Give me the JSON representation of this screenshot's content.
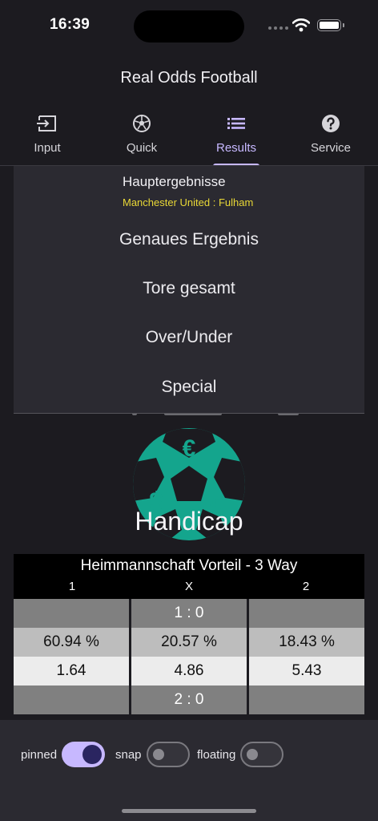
{
  "status": {
    "time": "16:39"
  },
  "app": {
    "title": "Real Odds Football"
  },
  "tabs": [
    {
      "label": "Input",
      "icon": "input-icon"
    },
    {
      "label": "Quick",
      "icon": "soccer-ball-icon"
    },
    {
      "label": "Results",
      "icon": "list-icon",
      "active": true
    },
    {
      "label": "Service",
      "icon": "help-icon"
    }
  ],
  "menu": {
    "title": "Hauptergebnisse",
    "subtitle": "Manchester United : Fulham",
    "options": [
      "Genaues Ergebnis",
      "Tore gesamt",
      "Over/Under",
      "Special"
    ]
  },
  "section": {
    "title": "Handicap",
    "logo_icon": "money-ball-icon"
  },
  "table": {
    "title": "Heimmannschaft Vorteil - 3 Way",
    "headers": [
      "1",
      "X",
      "2"
    ],
    "rows": [
      {
        "type": "score",
        "cells": [
          "",
          "1 : 0",
          ""
        ]
      },
      {
        "type": "pct",
        "cells": [
          "60.94 %",
          "20.57 %",
          "18.43 %"
        ]
      },
      {
        "type": "odd",
        "cells": [
          "1.64",
          "4.86",
          "5.43"
        ]
      },
      {
        "type": "score",
        "cells": [
          "",
          "2 : 0",
          ""
        ]
      }
    ]
  },
  "controls": [
    {
      "label": "pinned",
      "on": true
    },
    {
      "label": "snap",
      "on": false
    },
    {
      "label": "floating",
      "on": false
    }
  ],
  "colors": {
    "accent": "#c7b8ff",
    "ball": "#14a58d",
    "subtitle": "#e9d836"
  }
}
